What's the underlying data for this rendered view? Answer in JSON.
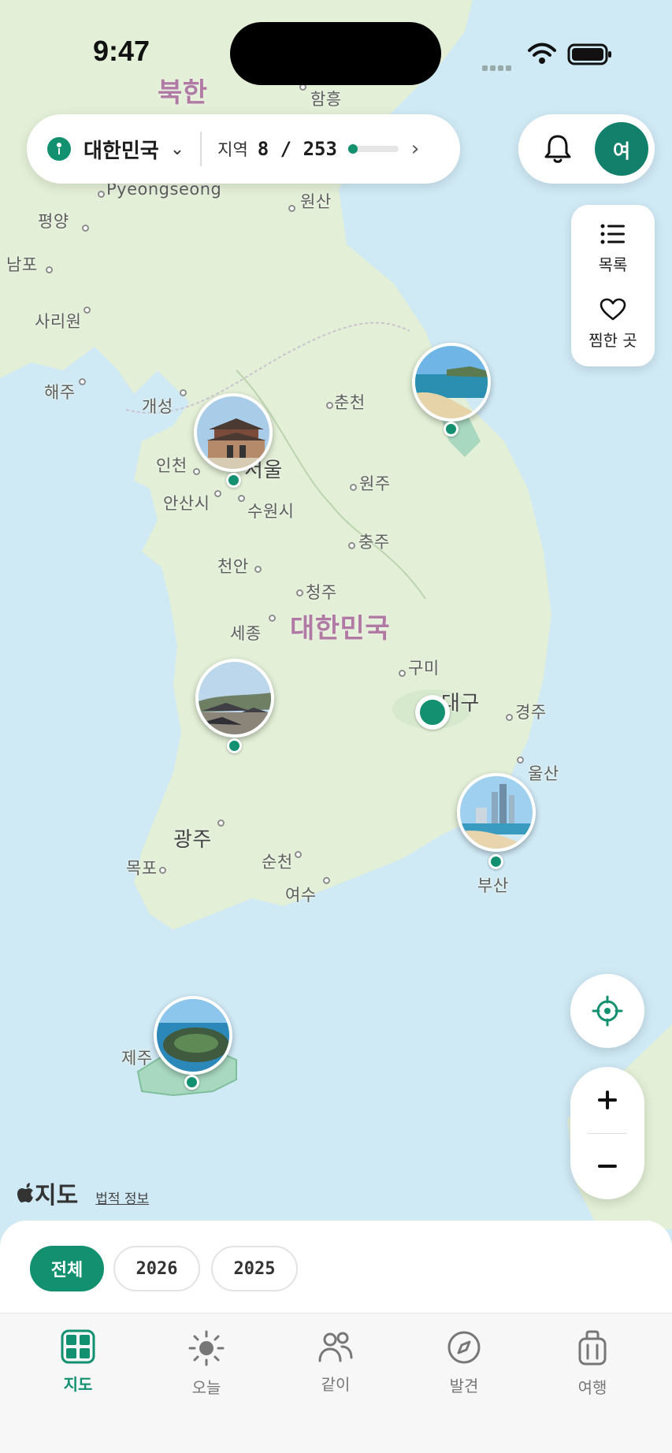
{
  "status_bar": {
    "time": "9:47"
  },
  "map": {
    "places": {
      "bukhan": "북한",
      "hamheung": "함흥",
      "pyeongseong": "Pyeongseong",
      "wonsan": "원산",
      "pyongyang": "평양",
      "nampo": "남포",
      "sariwon": "사리원",
      "haeju": "해주",
      "gaeseong": "개성",
      "chuncheon": "춘천",
      "incheon": "인천",
      "seoul": "서울",
      "ansan": "안산시",
      "suwon": "수원시",
      "wonju": "원주",
      "chungju": "충주",
      "cheonan": "천안",
      "cheongju": "청주",
      "sejong": "세종",
      "daehanminguk": "대한민국",
      "gumi": "구미",
      "daegu": "대구",
      "gyeongju": "경주",
      "ulsan": "울산",
      "gwangju": "광주",
      "suncheon": "순천",
      "mokpo": "목포",
      "yeosu": "여수",
      "busan": "부산",
      "jeju": "제주"
    },
    "attribution": {
      "logo": "지도",
      "legal": "법적 정보"
    }
  },
  "region_selector": {
    "country": "대한민국",
    "label": "지역",
    "count": "8 / 253",
    "visited": 8,
    "total": 253
  },
  "header": {
    "avatar_initial": "여"
  },
  "side_menu": {
    "list_label": "목록",
    "favorites_label": "찜한 곳"
  },
  "filters": [
    {
      "label": "전체",
      "active": true
    },
    {
      "label": "2026",
      "active": false
    },
    {
      "label": "2025",
      "active": false
    }
  ],
  "tabs": [
    {
      "label": "지도",
      "icon": "map-grid-icon",
      "active": true
    },
    {
      "label": "오늘",
      "icon": "sun-icon",
      "active": false
    },
    {
      "label": "같이",
      "icon": "people-icon",
      "active": false
    },
    {
      "label": "발견",
      "icon": "compass-icon",
      "active": false
    },
    {
      "label": "여행",
      "icon": "luggage-icon",
      "active": false
    }
  ],
  "colors": {
    "accent": "#12906f",
    "sea": "#cfe9f5",
    "land": "#e3efd6"
  }
}
